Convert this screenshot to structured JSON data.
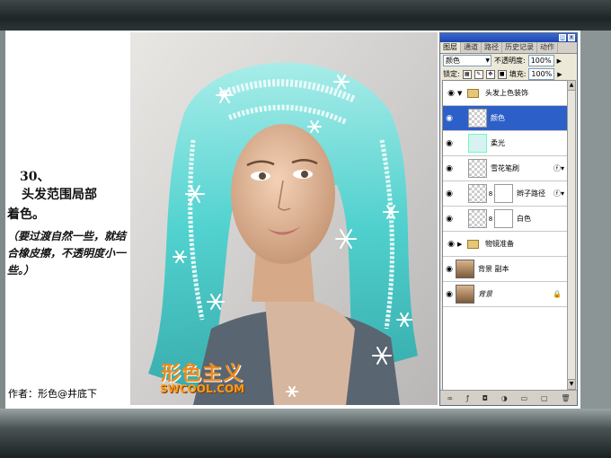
{
  "tutorial": {
    "step_number": "30、",
    "step_title_line1": "头发范围局部",
    "step_title_line2": "着色。",
    "step_note": "（要过渡自然一些，就结合橡皮擦，不透明度小一些。）",
    "author": "作者：形色@井底下"
  },
  "watermark": {
    "title": "形色主义",
    "url": "SWCOOL.COM"
  },
  "layers_panel": {
    "tabs": [
      "图层",
      "通道",
      "路径",
      "历史记录",
      "动作"
    ],
    "active_tab": "图层",
    "blend_mode": "颜色",
    "opacity_label": "不透明度:",
    "opacity_value": "100%",
    "lock_label": "锁定:",
    "fill_label": "填充:",
    "fill_value": "100%",
    "layers": [
      {
        "name": "头发上色装饰",
        "kind": "group-open"
      },
      {
        "name": "颜色",
        "kind": "layer-selected"
      },
      {
        "name": "柔光",
        "kind": "layer-teal"
      },
      {
        "name": "雪花笔刷",
        "kind": "layer-fx"
      },
      {
        "name": "辫子路径",
        "kind": "layer-mask-fx"
      },
      {
        "name": "白色",
        "kind": "layer-mask"
      },
      {
        "name": "物镜准备",
        "kind": "group-closed"
      },
      {
        "name": "背景 副本",
        "kind": "photo"
      },
      {
        "name": "背景",
        "kind": "photo-locked"
      }
    ]
  },
  "colors": {
    "accent_selected": "#2d5fc8",
    "hair_teal": "#3ad2cf",
    "watermark_orange": "#f08a1c"
  }
}
